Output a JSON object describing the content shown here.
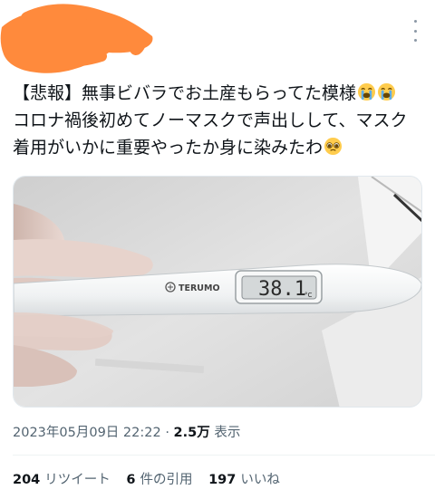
{
  "tweet": {
    "lines": [
      "【悲報】無事ビバラでお土産もらってた模様",
      "コロナ禍後初めてノーマスクで声出しして、マスク",
      "着用がいかに重要やったか身に染みたわ"
    ],
    "line1_emojis": [
      "loudly-crying-face",
      "loudly-crying-face"
    ],
    "line3_emoji": "pleading-face"
  },
  "media": {
    "thermometer_brand": "TERUMO",
    "display_value": "38.1",
    "display_unit": "°C"
  },
  "meta": {
    "timestamp": "2023年05月09日 22:22",
    "separator": "·",
    "views_count": "2.5万",
    "views_label": "表示"
  },
  "stats": {
    "retweets_count": "204",
    "retweets_label": "リツイート",
    "quotes_count": "6",
    "quotes_label": "件の引用",
    "likes_count": "197",
    "likes_label": "いいね"
  },
  "colors": {
    "redaction": "#ff8a3c",
    "text_primary": "#0f1419",
    "text_secondary": "#536471"
  },
  "icons": {
    "more": "more-options-icon"
  }
}
